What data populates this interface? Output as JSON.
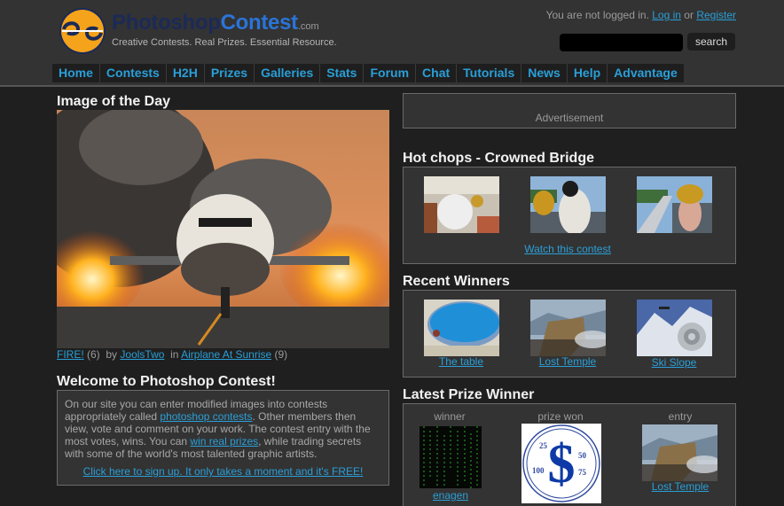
{
  "header": {
    "brand_part1": "Photoshop",
    "brand_part2": "Contest",
    "brand_suffix": ".com",
    "tagline": "Creative Contests. Real Prizes. Essential Resource.",
    "login_prefix": "You are not logged in.",
    "login_link": "Log in",
    "login_or": "or",
    "register_link": "Register",
    "search_value": "",
    "search_button": "search",
    "logo_icon": "pc-logo-icon"
  },
  "nav": {
    "items": [
      "Home",
      "Contests",
      "H2H",
      "Prizes",
      "Galleries",
      "Stats",
      "Forum",
      "Chat",
      "Tutorials",
      "News",
      "Help",
      "Advantage"
    ]
  },
  "image_of_day": {
    "title": "Image of the Day",
    "image_alt": "Burning airplane at sunrise",
    "entry_title": "FIRE!",
    "entry_count": "(6)",
    "by": "by",
    "author": "JoolsTwo",
    "in": "in",
    "contest": "Airplane At Sunrise",
    "contest_count": "(9)"
  },
  "welcome": {
    "title": "Welcome to Photoshop Contest!",
    "text_1": "On our site you can enter modified images into contests appropriately called ",
    "link_1": "photoshop contests",
    "text_2": ". Other members then view, vote and comment on your work. The contest entry with the most votes, wins. You can ",
    "link_2": "win real prizes",
    "text_3": ", while trading secrets with some of the world's most talented graphic artists.",
    "signup_link": "Click here to sign up. It only takes a moment and it's FREE!"
  },
  "advertisement": {
    "label": "Advertisement"
  },
  "hot_chops": {
    "title": "Hot chops - Crowned Bridge",
    "thumbnails": [
      "coronation scene",
      "man with crown on bridge",
      "crowned woman on bridge"
    ],
    "watch_link": "Watch this contest"
  },
  "recent_winners": {
    "title": "Recent Winners",
    "items": [
      {
        "label": "The table",
        "thumb": "swimming pool"
      },
      {
        "label": "Lost Temple",
        "thumb": "cliff temple"
      },
      {
        "label": "Ski Slope",
        "thumb": "ski slope"
      }
    ]
  },
  "latest_prize": {
    "title": "Latest Prize Winner",
    "winner_label": "winner",
    "prize_label": "prize won",
    "entry_label": "entry",
    "winner_name": "enagen",
    "prize_dial": [
      "25",
      "50",
      "75",
      "100"
    ],
    "entry_name": "Lost Temple"
  },
  "colors": {
    "link": "#2a9fd8",
    "header_bg": "#333333",
    "page_bg": "#1f1f1f",
    "logo_orange": "#f5a31a"
  }
}
